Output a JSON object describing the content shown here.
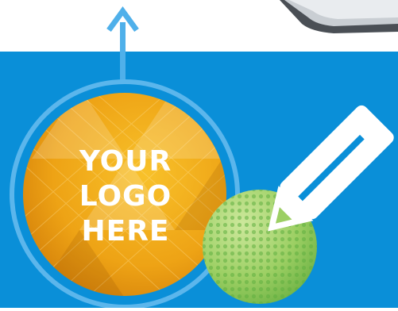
{
  "colors": {
    "background_top": "#ffffff",
    "panel_blue": "#0a8fd8",
    "ring_light_blue": "#5bb6ec",
    "arrow_blue": "#4fb0ea",
    "gold_light": "#f6b21a",
    "gold_dark": "#d9860a",
    "ball_green_light": "#b8dd84",
    "ball_green_dark": "#5fae3f",
    "pencil_white": "#ffffff"
  },
  "logo_placeholder": {
    "lines": [
      "YOUR",
      "LOGO",
      "HERE"
    ]
  },
  "icons": {
    "arrow": "up-arrow-icon",
    "pencil": "pencil-icon",
    "ball": "golf-ball"
  }
}
